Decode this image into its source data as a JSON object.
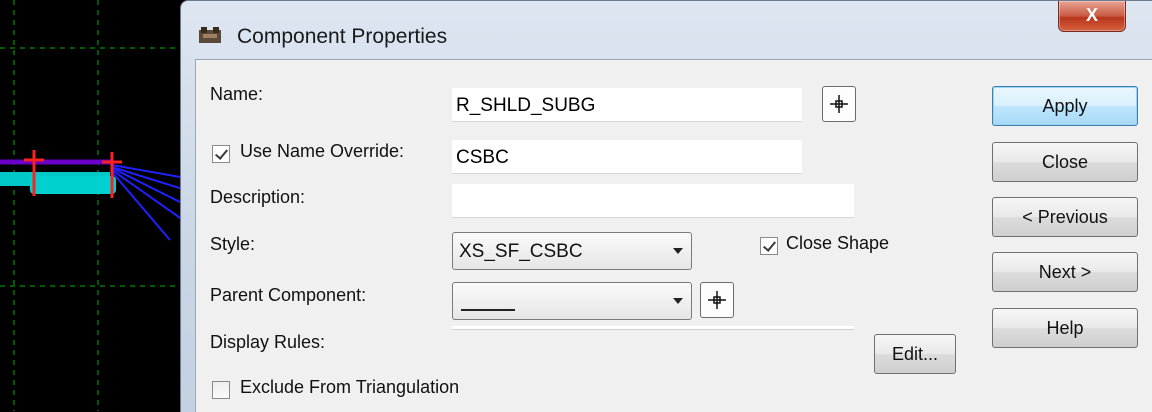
{
  "window": {
    "title": "Component Properties",
    "close_glyph": "X"
  },
  "form": {
    "name_label": "Name:",
    "name_value": "R_SHLD_SUBG",
    "use_override_label": "Use Name Override:",
    "use_override_checked": true,
    "override_value": "CSBC",
    "description_label": "Description:",
    "description_value": "",
    "style_label": "Style:",
    "style_value": "XS_SF_CSBC",
    "close_shape_label": "Close Shape",
    "close_shape_checked": true,
    "parent_label": "Parent Component:",
    "parent_value": "",
    "display_rules_label": "Display Rules:",
    "edit_label": "Edit...",
    "exclude_label": "Exclude From Triangulation",
    "exclude_checked": false
  },
  "buttons": {
    "apply": "Apply",
    "close": "Close",
    "previous": "< Previous",
    "next": "Next >",
    "help": "Help"
  },
  "icons": {
    "title": "component-app-icon",
    "pick": "target-pick-icon"
  },
  "colors": {
    "default_button_border": "#3c7fb1",
    "close_button": "#c95b44",
    "cad_background": "#000000",
    "cad_component": "#00c8c8",
    "cad_points": "#ff2020",
    "cad_lines": "#2020ff",
    "cad_grid": "#00b400"
  }
}
